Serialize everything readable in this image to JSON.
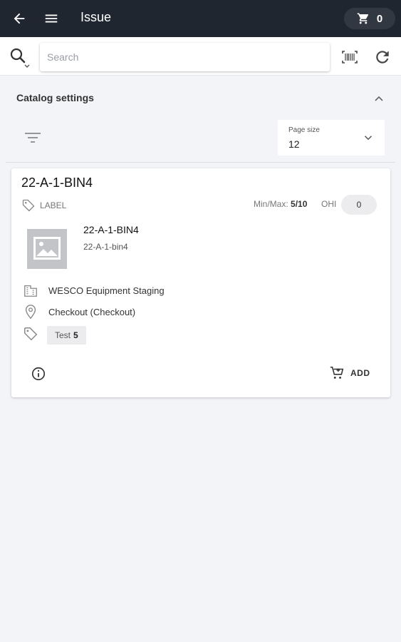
{
  "header": {
    "title": "Issue",
    "cart_count": "0",
    "icons": [
      "arrow-left-icon",
      "hamburger-menu-icon",
      "cart-icon"
    ]
  },
  "search": {
    "placeholder": "Search",
    "value": "",
    "icons": [
      "search-icon",
      "barcode-scan-icon",
      "refresh-icon"
    ]
  },
  "catalog_settings": {
    "title": "Catalog settings",
    "page_size_label": "Page size",
    "page_size_value": "12"
  },
  "items": [
    {
      "title": "22-A-1-BIN4",
      "label_tag": "LABEL",
      "minmax_label": "Min/Max:",
      "minmax_value": "5/10",
      "ohi_label": "OHI",
      "ohi_value": "0",
      "name": "22-A-1-BIN4",
      "code": "22-A-1-bin4",
      "site": "WESCO Equipment Staging",
      "location": "Checkout (Checkout)",
      "tag_name": "Test",
      "tag_count": "5",
      "add_label": "ADD"
    }
  ],
  "colors": {
    "appbar": "#202630",
    "background": "#f3f4f8",
    "card": "#ffffff",
    "pill": "#ececee"
  }
}
